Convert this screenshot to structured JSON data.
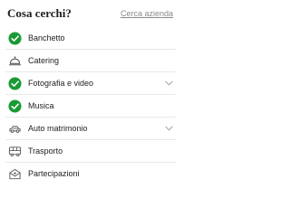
{
  "header": {
    "title": "Cosa cerchi?",
    "search_link": "Cerca azienda"
  },
  "colors": {
    "accent_green": "#1a9a35",
    "icon_gray": "#555555",
    "chevron_gray": "#9a9a9a"
  },
  "categories": [
    {
      "label": "Banchetto",
      "icon": "check-circle-icon",
      "selected": true,
      "expandable": false
    },
    {
      "label": "Catering",
      "icon": "cloche-icon",
      "selected": false,
      "expandable": false
    },
    {
      "label": "Fotografia e video",
      "icon": "check-circle-icon",
      "selected": true,
      "expandable": true
    },
    {
      "label": "Musica",
      "icon": "check-circle-icon",
      "selected": true,
      "expandable": false
    },
    {
      "label": "Auto matrimonio",
      "icon": "car-icon",
      "selected": false,
      "expandable": true
    },
    {
      "label": "Trasporto",
      "icon": "bus-icon",
      "selected": false,
      "expandable": false
    },
    {
      "label": "Partecipazioni",
      "icon": "envelope-icon",
      "selected": false,
      "expandable": false
    }
  ]
}
